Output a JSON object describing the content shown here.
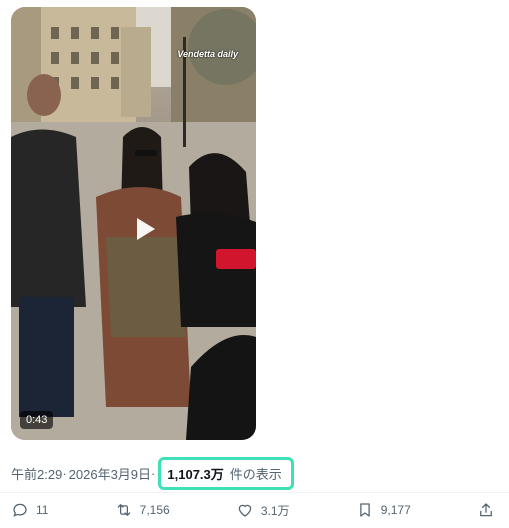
{
  "video": {
    "watermark": "Vendetta daily",
    "duration": "0:43"
  },
  "post": {
    "time": "午前2:29",
    "separator": "·",
    "date": "2026年3月9日",
    "views_count": "1,107.3万",
    "views_label": "件の表示"
  },
  "actions": {
    "reply_count": "11",
    "repost_count": "7,156",
    "like_count": "3.1万",
    "bookmark_count": "9,177"
  },
  "colors": {
    "highlight_border": "#3ee0b8",
    "secondary_text": "#536471"
  }
}
